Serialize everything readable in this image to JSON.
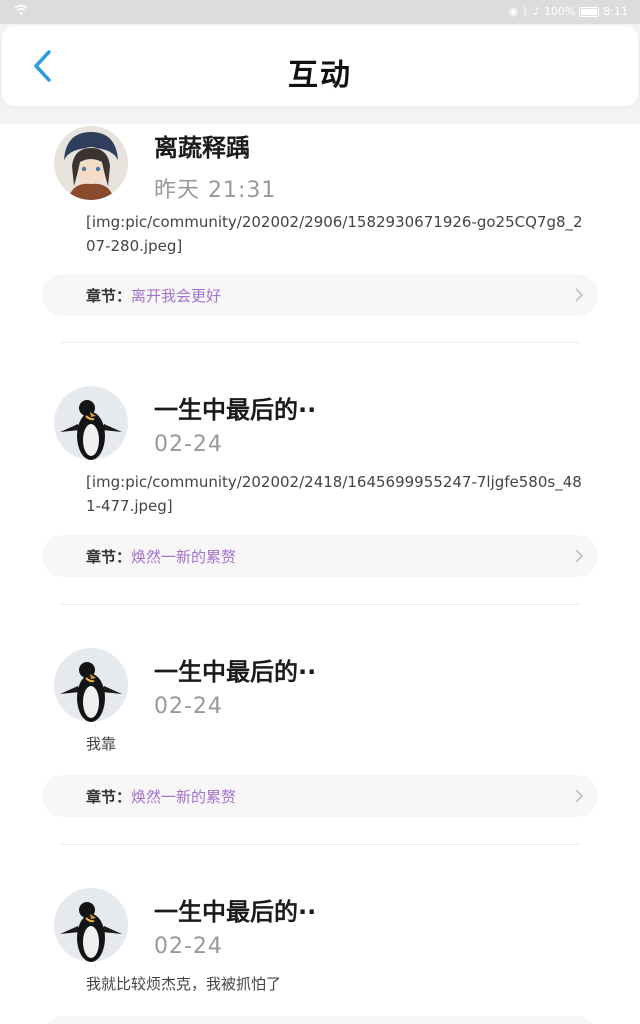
{
  "status_bar": {
    "battery_text": "100%",
    "time": "8:11"
  },
  "header": {
    "title": "互动"
  },
  "posts": [
    {
      "username": "离蔬释踽",
      "time": "昨天 21:31",
      "text": "[img:pic/community/202002/2906/1582930671926-go25CQ7g8_207-280.jpeg]",
      "chapter_label": "章节：",
      "chapter_name": "离开我会更好",
      "avatar": "anime-girl-avatar"
    },
    {
      "username": "一生中最后的··",
      "time": "02-24",
      "text": "[img:pic/community/202002/2418/1645699955247-7ljgfe580s_481-477.jpeg]",
      "chapter_label": "章节：",
      "chapter_name": "焕然一新的累赘",
      "avatar": "penguin-avatar"
    },
    {
      "username": "一生中最后的··",
      "time": "02-24",
      "text": "我靠",
      "chapter_label": "章节：",
      "chapter_name": "焕然一新的累赘",
      "avatar": "penguin-avatar"
    },
    {
      "username": "一生中最后的··",
      "time": "02-24",
      "text": "我就比较烦杰克，我被抓怕了",
      "avatar": "penguin-avatar"
    }
  ],
  "colors": {
    "accent": "#2d9fe0",
    "chapter": "#a572c9"
  }
}
